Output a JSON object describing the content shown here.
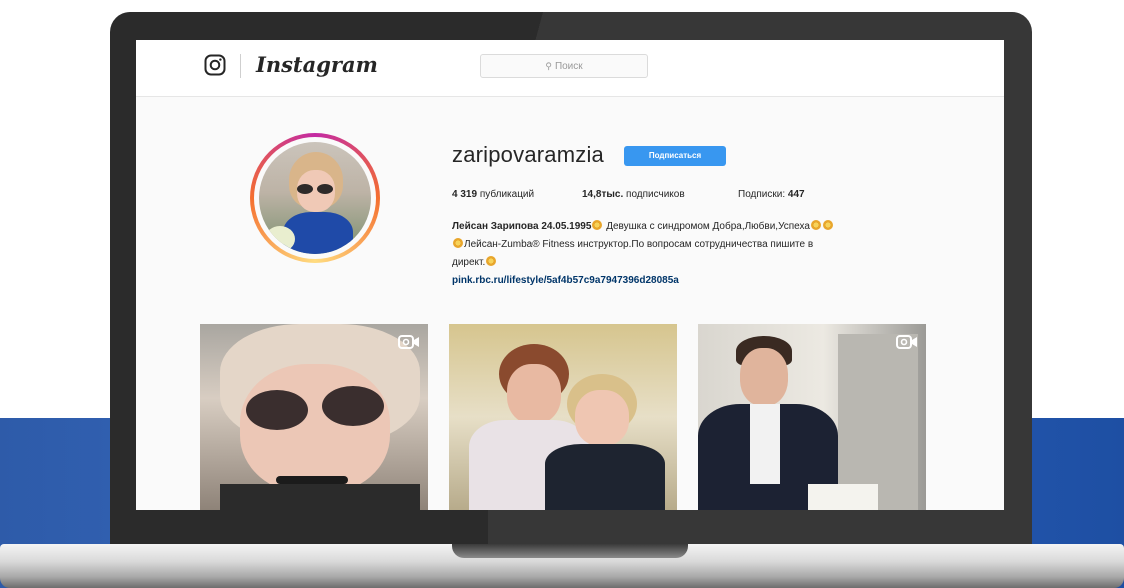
{
  "brand": {
    "wordmark": "Instagram",
    "glyph_icon": "instagram-camera-icon"
  },
  "search": {
    "placeholder": "Поиск",
    "icon": "search-icon"
  },
  "profile": {
    "username": "zaripovaramzia",
    "follow_label": "Подписаться",
    "stats": {
      "posts_count": "4 319",
      "posts_label": "публикаций",
      "followers_count": "14,8тыс.",
      "followers_label": "подписчиков",
      "following_label": "Подписки:",
      "following_count": "447"
    },
    "bio": {
      "name": "Лейсан Зарипова 24.05.1995",
      "line1_rest": "Девушка с синдромом Добра,Любви,Успеха",
      "line2": "Лейсан-Zumba® Fitness инструктор.По вопросам сотрудничества пишите в",
      "line3": "директ.",
      "link": "pink.rbc.ru/lifestyle/5af4b57c9a7947396d28085a"
    }
  },
  "posts": [
    {
      "type": "video",
      "icon": "video-icon"
    },
    {
      "type": "photo"
    },
    {
      "type": "video",
      "icon": "video-icon"
    }
  ],
  "colors": {
    "follow_button": "#3897f0",
    "link": "#003569",
    "background_band": "#2a63c2"
  }
}
